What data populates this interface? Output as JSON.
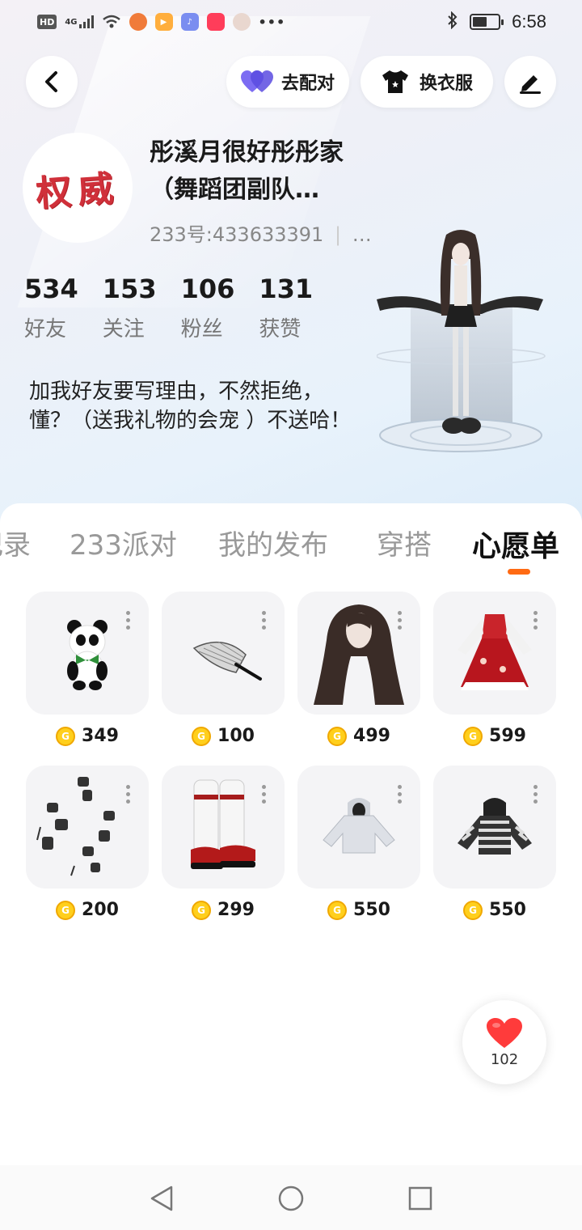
{
  "status_bar": {
    "hd": "HD",
    "signal": "4G",
    "time": "6:58",
    "battery_level": 0.55
  },
  "header": {
    "pair_label": "去配对",
    "dress_label": "换衣服"
  },
  "profile": {
    "avatar_text": "权威",
    "nickname": "彤溪月很好彤彤家（舞蹈团副队…",
    "user_id": "233号:433633391",
    "id_more": "…",
    "bio": "加我好友要写理由，不然拒绝，懂？（送我礼物的会宠 ）不送哈！"
  },
  "stats": [
    {
      "value": "534",
      "label": "好友"
    },
    {
      "value": "153",
      "label": "关注"
    },
    {
      "value": "106",
      "label": "粉丝"
    },
    {
      "value": "131",
      "label": "获赞"
    }
  ],
  "tabs": [
    {
      "label": "记录"
    },
    {
      "label": "233派对"
    },
    {
      "label": "我的发布"
    },
    {
      "label": "穿搭"
    },
    {
      "label": "心愿单",
      "active": true
    }
  ],
  "wishlist": [
    {
      "name": "panda-item",
      "price": "349"
    },
    {
      "name": "fan-item",
      "price": "100"
    },
    {
      "name": "long-hair-item",
      "price": "499"
    },
    {
      "name": "red-dress-item",
      "price": "599"
    },
    {
      "name": "tattoo-item",
      "price": "200"
    },
    {
      "name": "boots-item",
      "price": "299"
    },
    {
      "name": "grey-hoodie-item",
      "price": "550"
    },
    {
      "name": "striped-sweater-item",
      "price": "550"
    }
  ],
  "like": {
    "count": "102"
  },
  "colors": {
    "accent": "#ff6a13",
    "coin": "#ffcf1c",
    "heart": "#ff3b3b",
    "avatar_text": "#d0303a"
  },
  "icons": {
    "back": "chevron-left-icon",
    "pair": "heart-icon",
    "dress": "tshirt-icon",
    "edit": "pen-icon",
    "like": "heart-icon"
  }
}
